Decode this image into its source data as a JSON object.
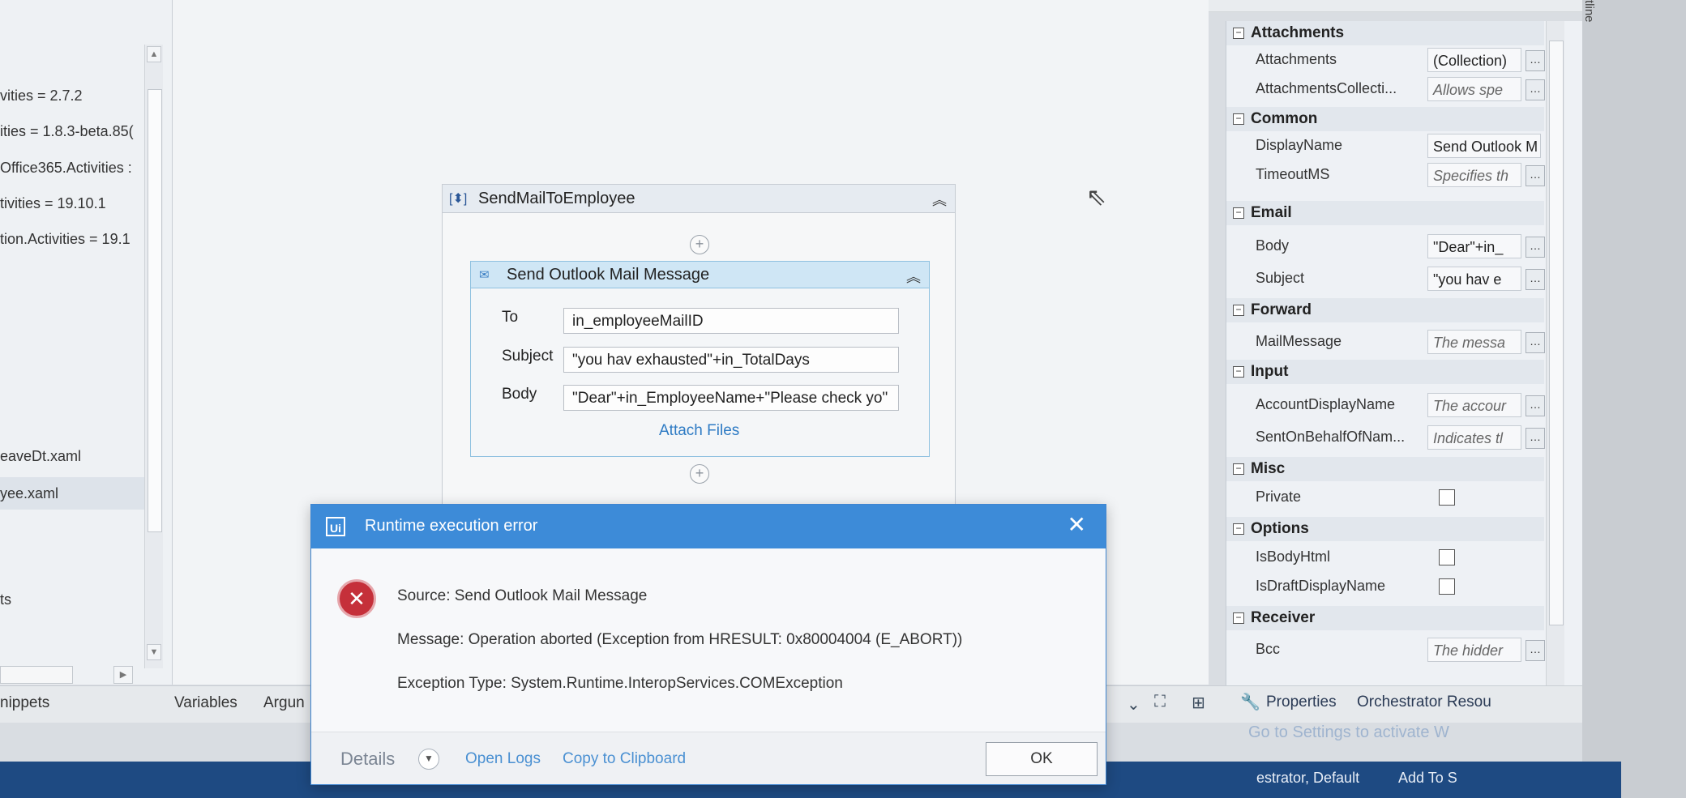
{
  "left_panel": {
    "dependencies": [
      "vities = 2.7.2",
      "ities = 1.8.3-beta.85(",
      "Office365.Activities :",
      "tivities = 19.10.1",
      "tion.Activities = 19.1"
    ],
    "files": [
      "eaveDt.xaml",
      "yee.xaml"
    ],
    "section_label": "ts"
  },
  "designer": {
    "sequence_title": "SendMailToEmployee",
    "activity_title": "Send Outlook Mail Message",
    "fields": [
      {
        "label": "To",
        "value": "in_employeeMailID"
      },
      {
        "label": "Subject",
        "value": "\"you hav exhausted\"+in_TotalDays"
      },
      {
        "label": "Body",
        "value": "\"Dear\"+in_EmployeeName+\"Please check yo\""
      }
    ],
    "attach_files": "Attach Files"
  },
  "bottom_tabs": [
    "nippets",
    "Variables",
    "Argun"
  ],
  "properties": {
    "categories": [
      {
        "name": "Attachments",
        "rows": [
          {
            "name": "Attachments",
            "value": "(Collection)",
            "hint": false
          },
          {
            "name": "AttachmentsCollecti...",
            "value": "Allows spe",
            "hint": true
          }
        ]
      },
      {
        "name": "Common",
        "rows": [
          {
            "name": "DisplayName",
            "value": "Send Outlook M",
            "hint": false
          },
          {
            "name": "TimeoutMS",
            "value": "Specifies th",
            "hint": true
          }
        ]
      },
      {
        "name": "Email",
        "rows": [
          {
            "name": "Body",
            "value": "\"Dear\"+in_",
            "hint": false
          },
          {
            "name": "Subject",
            "value": "\"you hav e",
            "hint": false
          }
        ]
      },
      {
        "name": "Forward",
        "rows": [
          {
            "name": "MailMessage",
            "value": "The messa",
            "hint": true
          }
        ]
      },
      {
        "name": "Input",
        "rows": [
          {
            "name": "AccountDisplayName",
            "value": "The accour",
            "hint": true
          },
          {
            "name": "SentOnBehalfOfNam...",
            "value": "Indicates tl",
            "hint": true
          }
        ]
      },
      {
        "name": "Misc",
        "rows": [
          {
            "name": "Private",
            "checkbox": true
          }
        ]
      },
      {
        "name": "Options",
        "rows": [
          {
            "name": "IsBodyHtml",
            "checkbox": true
          },
          {
            "name": "IsDraftDisplayName",
            "checkbox": true
          }
        ]
      },
      {
        "name": "Receiver",
        "rows": [
          {
            "name": "Bcc",
            "value": "The hidder",
            "hint": true
          }
        ]
      }
    ],
    "tabs": [
      "Properties",
      "Orchestrator Resou"
    ],
    "outline_label": "tline"
  },
  "status_bar": {
    "orchestrator": "estrator, Default",
    "add_to": "Add To S",
    "activate_text": "Go to Settings to activate W"
  },
  "dialog": {
    "title": "Runtime execution error",
    "logo": "Ui",
    "source": "Source: Send Outlook Mail Message",
    "message": "Message: Operation aborted (Exception from HRESULT: 0x80004004 (E_ABORT))",
    "exception_type": "Exception Type: System.Runtime.InteropServices.COMException",
    "details_label": "Details",
    "open_logs": "Open Logs",
    "copy_clipboard": "Copy to Clipboard",
    "ok_label": "OK"
  }
}
